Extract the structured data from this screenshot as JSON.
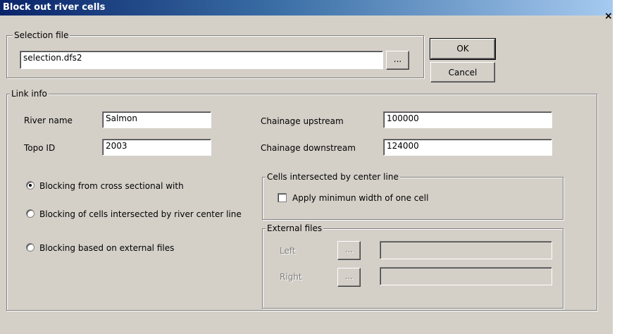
{
  "window": {
    "title": "Block out river cells",
    "close_glyph": "×"
  },
  "selection": {
    "legend": "Selection file",
    "file_value": "selection.dfs2",
    "browse_label": "..."
  },
  "buttons": {
    "ok": "OK",
    "cancel": "Cancel"
  },
  "link_info": {
    "legend": "Link info",
    "river_name_label": "River name",
    "river_name_value": "Salmon",
    "topo_id_label": "Topo ID",
    "topo_id_value": "2003",
    "chainage_up_label": "Chainage upstream",
    "chainage_up_value": "100000",
    "chainage_down_label": "Chainage downstream",
    "chainage_down_value": "124000"
  },
  "blocking": {
    "selected_index": 0,
    "options": [
      "Blocking from cross sectional with",
      "Blocking of cells intersected by river center line",
      "Blocking based on external files"
    ]
  },
  "center_line": {
    "legend": "Cells intersected by center line",
    "checkbox_label": "Apply minimun width of one cell",
    "checked": false
  },
  "external_files": {
    "legend": "External files",
    "left_label": "Left",
    "right_label": "Right",
    "browse_label": "...",
    "left_value": "",
    "right_value": ""
  }
}
